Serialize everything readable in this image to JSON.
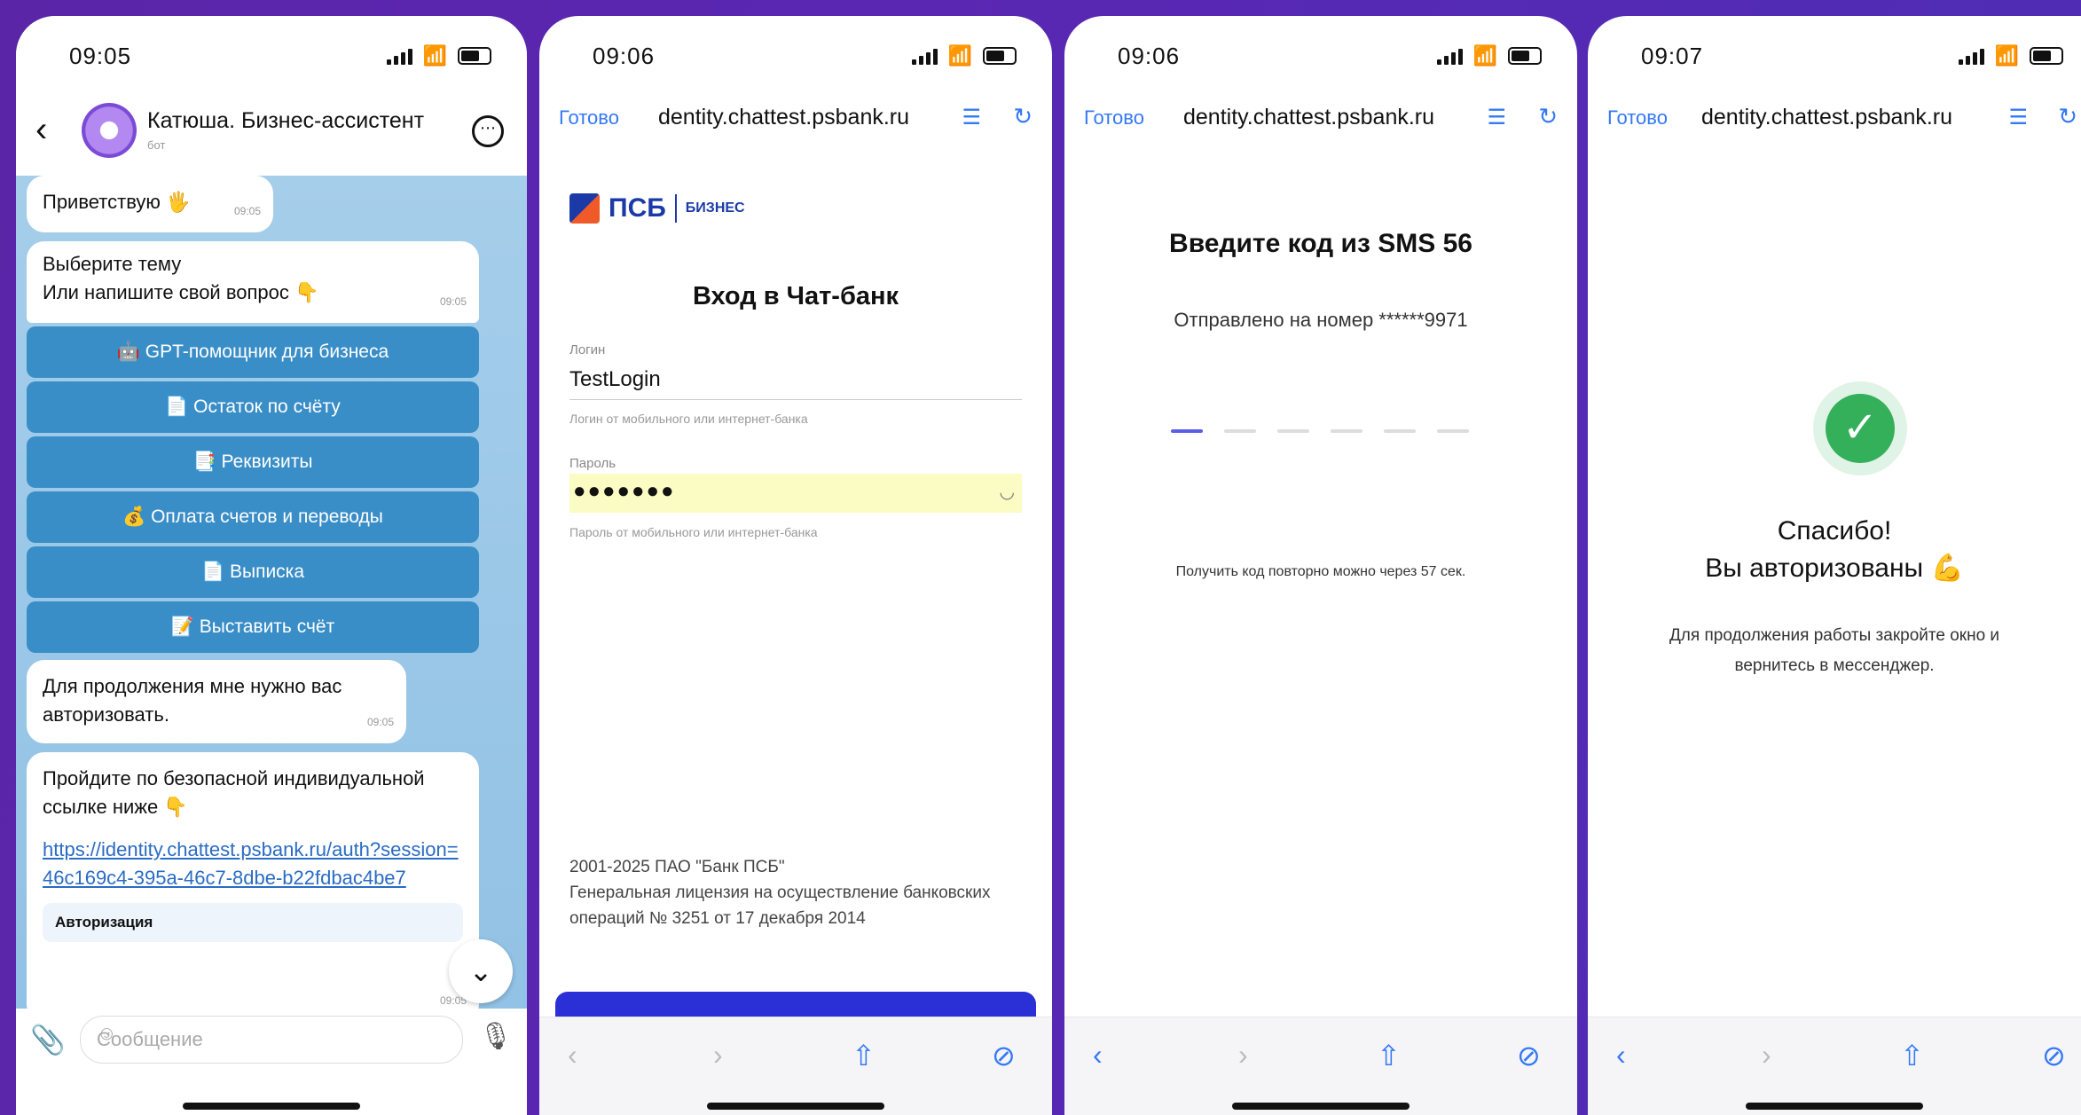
{
  "telegram": {
    "time": "09:05",
    "chat_name": "Катюша. Бизнес-ассистент",
    "chat_status": "бот",
    "messages": {
      "greet": {
        "text": "Приветствую 🖐",
        "time": "09:05"
      },
      "choose": {
        "line1": "Выберите тему",
        "line2": "Или напишите свой вопрос 👇",
        "time": "09:05"
      },
      "need_auth": {
        "text": "Для продолжения мне нужно вас авторизовать.",
        "time": "09:05"
      },
      "link_msg": {
        "text": "Пройдите по безопасной индивидуальной ссылке ниже 👇",
        "link": "https://identity.chattest.psbank.ru/auth?session=46c169c4-395a-46c7-8dbe-b22fdbac4be7",
        "button": "Авторизация",
        "time": "09:05"
      }
    },
    "keyboard": [
      "🤖 GPT-помощник для бизнеса",
      "📄 Остаток по счёту",
      "📑 Реквизиты",
      "💰 Оплата счетов и переводы",
      "📄 Выписка",
      "📝 Выставить счёт"
    ],
    "input_placeholder": "Сообщение"
  },
  "browser": {
    "done_label": "Готово",
    "url": "dentity.chattest.psbank.ru"
  },
  "login_page": {
    "time": "09:06",
    "logo_text": "ПСБ",
    "logo_sub": "БИЗНЕС",
    "title": "Вход в Чат-банк",
    "login_label": "Логин",
    "login_value": "TestLogin",
    "login_hint": "Логин от мобильного или интернет-банка",
    "password_label": "Пароль",
    "password_value": "●●●●●●●",
    "password_hint": "Пароль от мобильного или интернет-банка",
    "footer_line1": "2001-2025 ПАО \"Банк ПСБ\"",
    "footer_line2": "Генеральная лицензия на осуществление банковских операций № 3251 от 17 декабря 2014"
  },
  "sms_page": {
    "time": "09:06",
    "title": "Введите код из SMS 56",
    "sent_to": "Отправлено на номер ******9971",
    "code_length": 6,
    "resend": "Получить код повторно можно через 57 сек."
  },
  "success_page": {
    "time": "09:07",
    "line1": "Спасибо!",
    "line2": "Вы авторизованы 💪",
    "hint": "Для продолжения работы закройте окно и вернитесь в мессенджер."
  },
  "colors": {
    "accent": "#3478f6",
    "brand": "#1b3aa8",
    "success": "#35b05a",
    "background": "#5b25a8"
  }
}
